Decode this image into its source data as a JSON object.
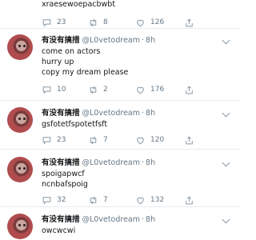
{
  "user": {
    "name": "有没有搞措",
    "handle": "@L0vetodream",
    "time": "8h"
  },
  "tweets": [
    {
      "lines": [
        "xraesewoepacbwbt"
      ],
      "replies": "23",
      "retweets": "8",
      "likes": "126"
    },
    {
      "lines": [
        "come on actors",
        "hurry up",
        "copy my dream please"
      ],
      "replies": "10",
      "retweets": "2",
      "likes": "176"
    },
    {
      "lines": [
        "gsfotetfspotetfsft"
      ],
      "replies": "23",
      "retweets": "7",
      "likes": "120"
    },
    {
      "lines": [
        "spoigapwcf",
        "ncnbafspoig"
      ],
      "replies": "32",
      "retweets": "7",
      "likes": "132"
    },
    {
      "lines": [
        "owcwcwi"
      ]
    }
  ],
  "icons": {
    "reply": "reply-icon",
    "retweet": "retweet-icon",
    "like": "heart-icon",
    "share": "share-icon",
    "more": "chevron-down-icon"
  },
  "colors": {
    "meta": "#657786",
    "divider": "#e6ecf0",
    "text": "#14171a"
  }
}
